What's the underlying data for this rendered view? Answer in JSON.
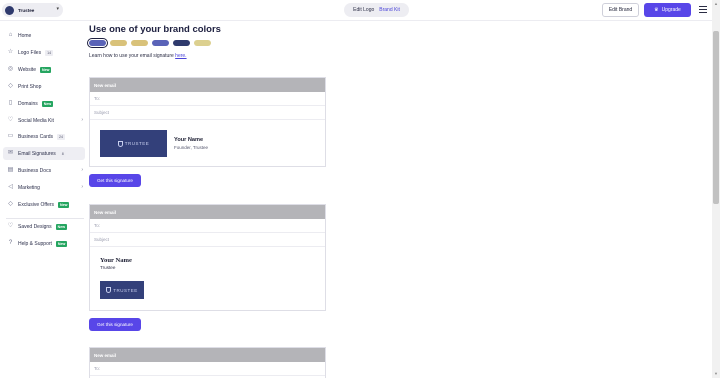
{
  "topbar": {
    "brand_name": "Trustee",
    "segment_edit_logo": "Edit Logo",
    "segment_brand_kit": "Brand Kit",
    "edit_brand": "Edit Brand",
    "upgrade": "Upgrade"
  },
  "sidebar": {
    "items": [
      {
        "label": "Home",
        "icon": "home-icon"
      },
      {
        "label": "Logo Files",
        "icon": "star-icon",
        "count": "14"
      },
      {
        "label": "Website",
        "icon": "globe-icon",
        "badge": "New"
      },
      {
        "label": "Print Shop",
        "icon": "tag-icon"
      },
      {
        "label": "Domains",
        "icon": "bookmark-icon",
        "badge": "New"
      },
      {
        "label": "Social Media Kit",
        "icon": "heart-icon"
      },
      {
        "label": "Business Cards",
        "icon": "card-icon",
        "count": "24"
      },
      {
        "label": "Email Signatures",
        "icon": "mail-icon",
        "count": "8"
      },
      {
        "label": "Business Docs",
        "icon": "document-icon"
      },
      {
        "label": "Marketing",
        "icon": "megaphone-icon"
      },
      {
        "label": "Exclusive Offers",
        "icon": "tag-icon",
        "badge": "New"
      },
      {
        "label": "Saved Designs",
        "icon": "heart-icon",
        "badge": "New"
      },
      {
        "label": "Help & Support",
        "icon": "help-icon",
        "badge": "New"
      }
    ]
  },
  "main": {
    "title": "Use one of your brand colors",
    "swatches": [
      "#5a63b8",
      "#d9c27a",
      "#d9c27a",
      "#5a63b8",
      "#2f3a6d",
      "#dcd08f"
    ],
    "learn_text": "Learn how to use your email signature",
    "learn_link": "here.",
    "cards": [
      {
        "header": "New email",
        "to": "To:",
        "subject": "Subject",
        "logo_text": "TRUSTEE",
        "name": "Your Name",
        "role": "Founder, Trustee",
        "button": "Get this signature"
      },
      {
        "header": "New email",
        "to": "To:",
        "subject": "Subject",
        "logo_text": "TRUSTEE",
        "name": "Your Name",
        "role": "Trustee",
        "button": "Get this signature"
      },
      {
        "header": "New email",
        "to": "To:"
      }
    ]
  }
}
